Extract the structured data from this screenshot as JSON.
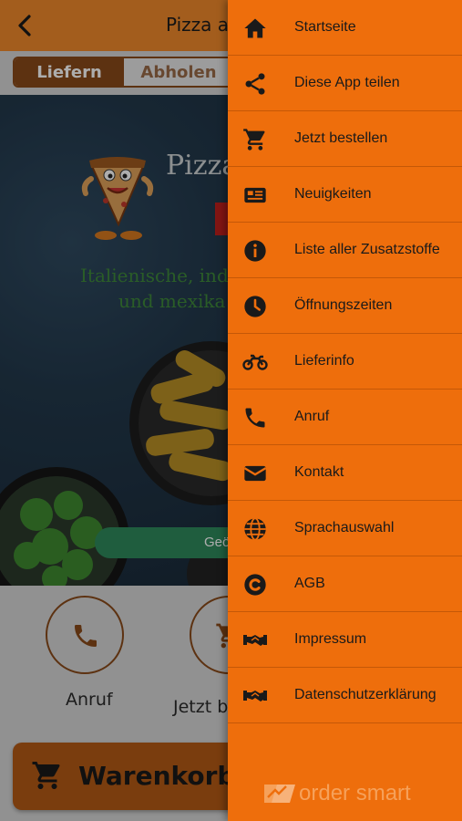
{
  "header": {
    "title": "Pizza a"
  },
  "segmented": {
    "delivery": "Liefern",
    "pickup": "Abholen"
  },
  "hero": {
    "title": "Pizza",
    "tagline_1": "Italienische, ind",
    "tagline_2": "und mexika",
    "status": "Geö"
  },
  "quick_actions": [
    {
      "label": "Anruf",
      "icon": "phone-icon"
    },
    {
      "label": "Jetzt b",
      "icon": "cart-icon"
    }
  ],
  "cart": {
    "label": "Warenkorb"
  },
  "menu": [
    {
      "label": "Startseite",
      "icon": "home-icon"
    },
    {
      "label": "Diese App teilen",
      "icon": "share-icon"
    },
    {
      "label": "Jetzt bestellen",
      "icon": "cart-icon"
    },
    {
      "label": "Neuigkeiten",
      "icon": "newspaper-icon"
    },
    {
      "label": "Liste aller Zusatzstoffe",
      "icon": "info-icon"
    },
    {
      "label": "Öffnungszeiten",
      "icon": "clock-icon"
    },
    {
      "label": "Lieferinfo",
      "icon": "motorcycle-icon"
    },
    {
      "label": "Anruf",
      "icon": "phone-icon"
    },
    {
      "label": "Kontakt",
      "icon": "envelope-icon"
    },
    {
      "label": "Sprachauswahl",
      "icon": "globe-icon"
    },
    {
      "label": "AGB",
      "icon": "copyright-icon"
    },
    {
      "label": "Impressum",
      "icon": "handshake-icon"
    },
    {
      "label": "Datenschutzerklärung",
      "icon": "handshake-icon"
    }
  ],
  "brand": {
    "text": "order smart"
  },
  "colors": {
    "topbar": "#f08a2c",
    "drawer": "#ee6e0c",
    "accent_brown": "#8a4a1a",
    "status_green": "#2e8a5c"
  }
}
